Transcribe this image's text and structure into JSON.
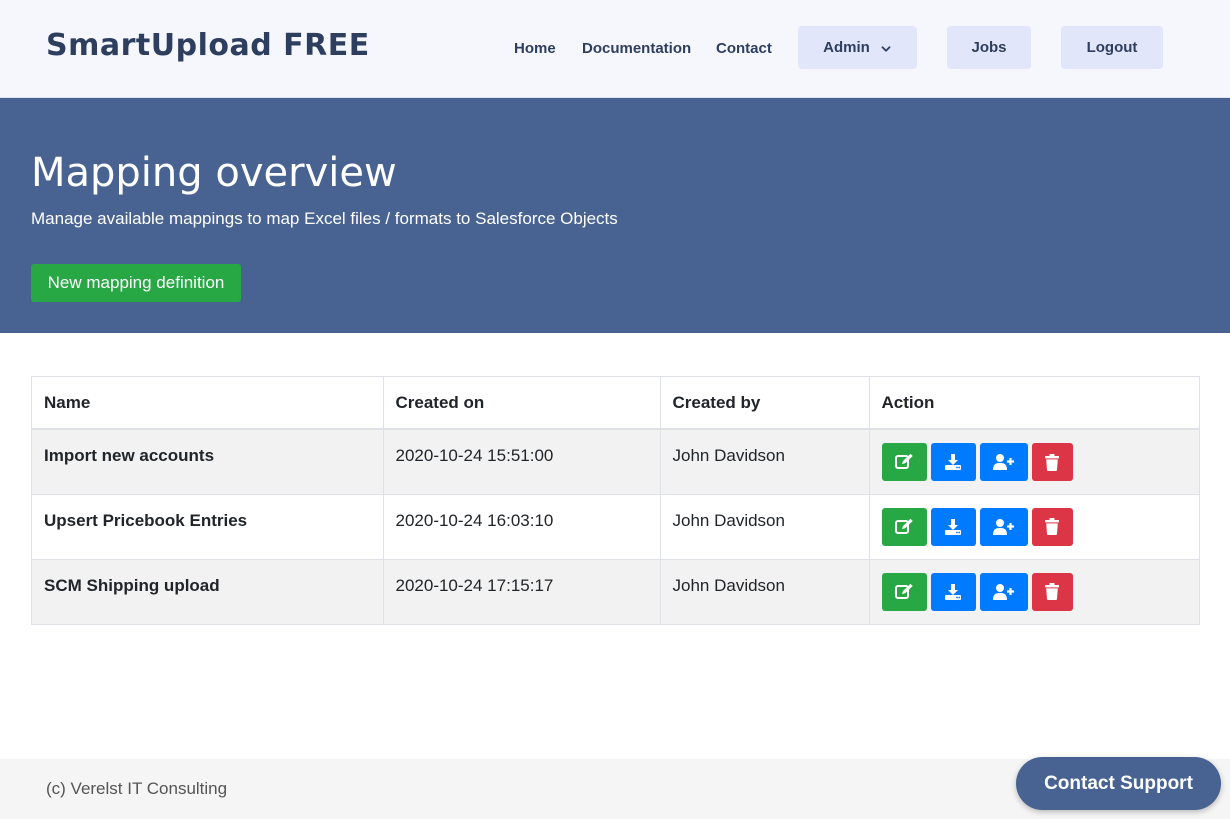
{
  "header": {
    "brand": "SmartUpload FREE",
    "nav": {
      "home": "Home",
      "documentation": "Documentation",
      "contact": "Contact",
      "admin": "Admin",
      "jobs": "Jobs",
      "logout": "Logout"
    }
  },
  "hero": {
    "title": "Mapping overview",
    "subtitle": "Manage available mappings to map Excel files / formats to Salesforce Objects",
    "new_button": "New mapping definition"
  },
  "table": {
    "columns": [
      "Name",
      "Created on",
      "Created by",
      "Action"
    ],
    "rows": [
      {
        "name": "Import new accounts",
        "created_on": "2020-10-24 15:51:00",
        "created_by": "John Davidson"
      },
      {
        "name": "Upsert Pricebook Entries",
        "created_on": "2020-10-24 16:03:10",
        "created_by": "John Davidson"
      },
      {
        "name": "SCM Shipping upload",
        "created_on": "2020-10-24 17:15:17",
        "created_by": "John Davidson"
      }
    ],
    "action_icons": [
      "edit-icon",
      "download-icon",
      "user-plus-icon",
      "trash-icon"
    ]
  },
  "footer": {
    "copyright": "(c) Verelst IT Consulting",
    "support_button": "Contact Support"
  },
  "colors": {
    "hero_bg": "#486391",
    "success": "#28a745",
    "primary": "#007bff",
    "danger": "#dc3545",
    "nav_button_bg": "#e2e6fb"
  }
}
